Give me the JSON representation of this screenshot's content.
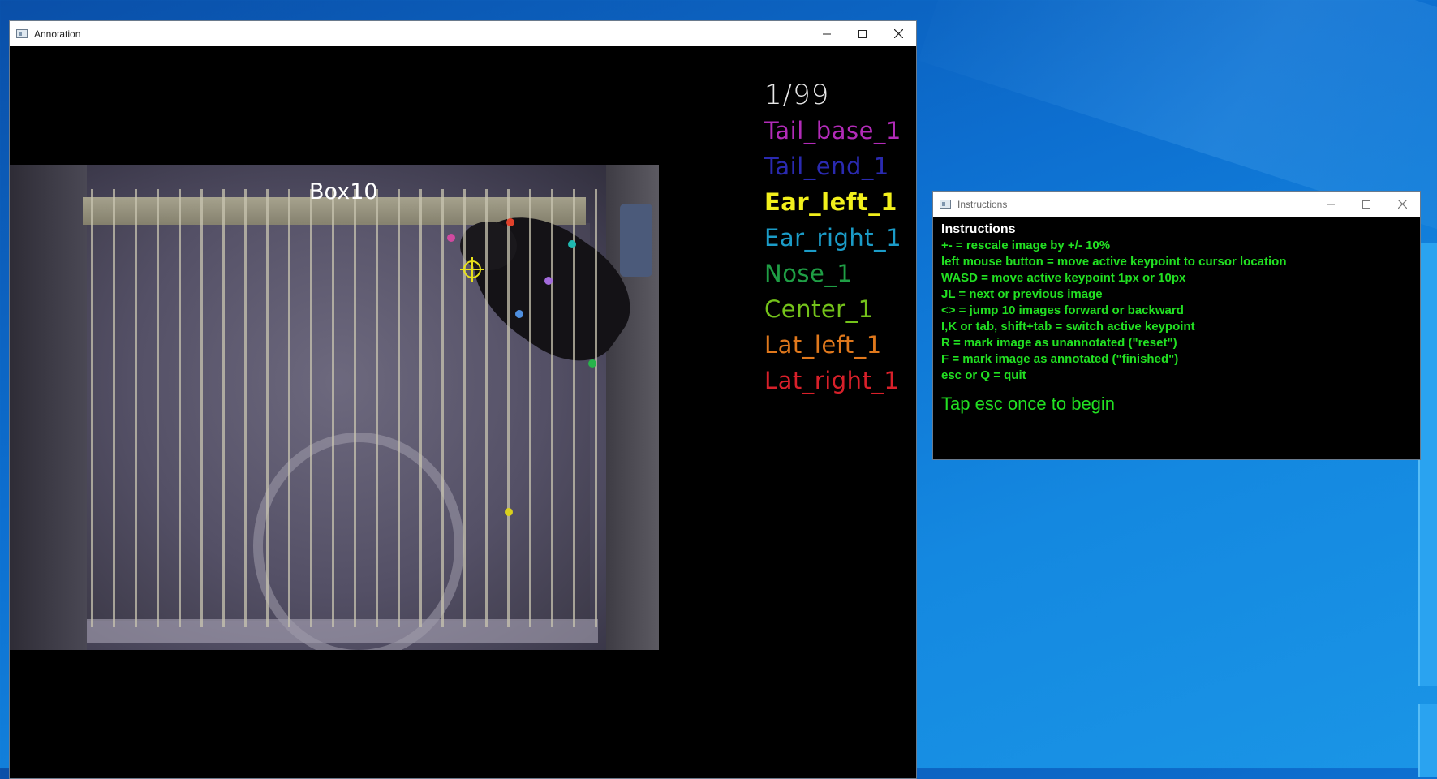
{
  "annotation_window": {
    "title": "Annotation",
    "image_label": "Box10",
    "counter": "1/99",
    "keypoints": [
      {
        "label": "Tail_base_1",
        "color": "#b22bb8",
        "active": false
      },
      {
        "label": "Tail_end_1",
        "color": "#2a2ab0",
        "active": false
      },
      {
        "label": "Ear_left_1",
        "color": "#f2f01c",
        "active": true
      },
      {
        "label": "Ear_right_1",
        "color": "#1b9cc8",
        "active": false
      },
      {
        "label": "Nose_1",
        "color": "#1f9e45",
        "active": false
      },
      {
        "label": "Center_1",
        "color": "#74c21a",
        "active": false
      },
      {
        "label": "Lat_left_1",
        "color": "#e0781c",
        "active": false
      },
      {
        "label": "Lat_right_1",
        "color": "#d8202a",
        "active": false
      }
    ]
  },
  "instructions_window": {
    "title": "Instructions",
    "heading": "Instructions",
    "lines": [
      "+- = rescale image by +/- 10%",
      "left mouse button = move active keypoint to cursor location",
      "WASD = move active keypoint 1px or 10px",
      "JL = next or previous image",
      "<> = jump 10 images forward or backward",
      "I,K or tab, shift+tab = switch active keypoint",
      "R = mark image as unannotated (\"reset\")",
      "F = mark image as annotated (\"finished\")",
      "esc or Q = quit"
    ],
    "prompt": "Tap esc once to begin"
  },
  "window_controls": {
    "minimize": "minimize-icon",
    "maximize": "maximize-icon",
    "close": "close-icon"
  }
}
